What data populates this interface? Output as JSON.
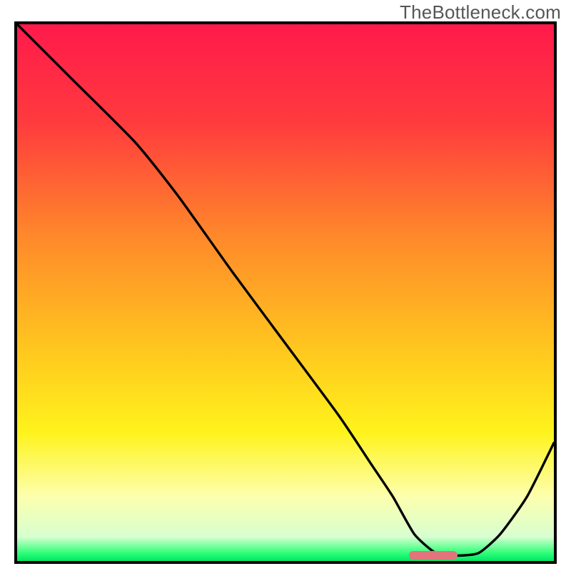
{
  "watermark": "TheBottleneck.com",
  "colors": {
    "frame": "#000000",
    "watermark_text": "#565656",
    "gradient_stops": [
      {
        "offset": 0.0,
        "color": "#ff1a4b"
      },
      {
        "offset": 0.18,
        "color": "#ff3a3e"
      },
      {
        "offset": 0.4,
        "color": "#ff8a2a"
      },
      {
        "offset": 0.6,
        "color": "#ffc51f"
      },
      {
        "offset": 0.76,
        "color": "#fff31c"
      },
      {
        "offset": 0.88,
        "color": "#fdffae"
      },
      {
        "offset": 0.955,
        "color": "#d7ffd0"
      },
      {
        "offset": 0.985,
        "color": "#2fff7a"
      },
      {
        "offset": 1.0,
        "color": "#00e664"
      }
    ],
    "curve": "#000000",
    "marker": "#e2747c"
  },
  "chart_data": {
    "type": "line",
    "title": "",
    "xlabel": "",
    "ylabel": "",
    "xlim": [
      0,
      100
    ],
    "ylim": [
      0,
      100
    ],
    "grid": false,
    "legend": false,
    "series": [
      {
        "name": "bottleneck-curve",
        "x": [
          0,
          10,
          22,
          30,
          40,
          50,
          60,
          66,
          70,
          74,
          78,
          82,
          86,
          90,
          95,
          100
        ],
        "y": [
          100,
          90,
          78,
          68,
          54,
          40.5,
          27,
          18,
          12,
          5,
          1.5,
          1,
          1.5,
          5,
          12,
          22
        ]
      }
    ],
    "marker": {
      "x_start": 73,
      "x_end": 82,
      "y": 1
    },
    "notes": "x and y are percentages of the plot area; y=0 is the bottom edge, y=100 is the top edge. Curve descends from top-left, inflects around x≈22, reaches a flat minimum near x≈78–82, then rises again to the right edge. The pill marker sits at the curve's minimum."
  }
}
